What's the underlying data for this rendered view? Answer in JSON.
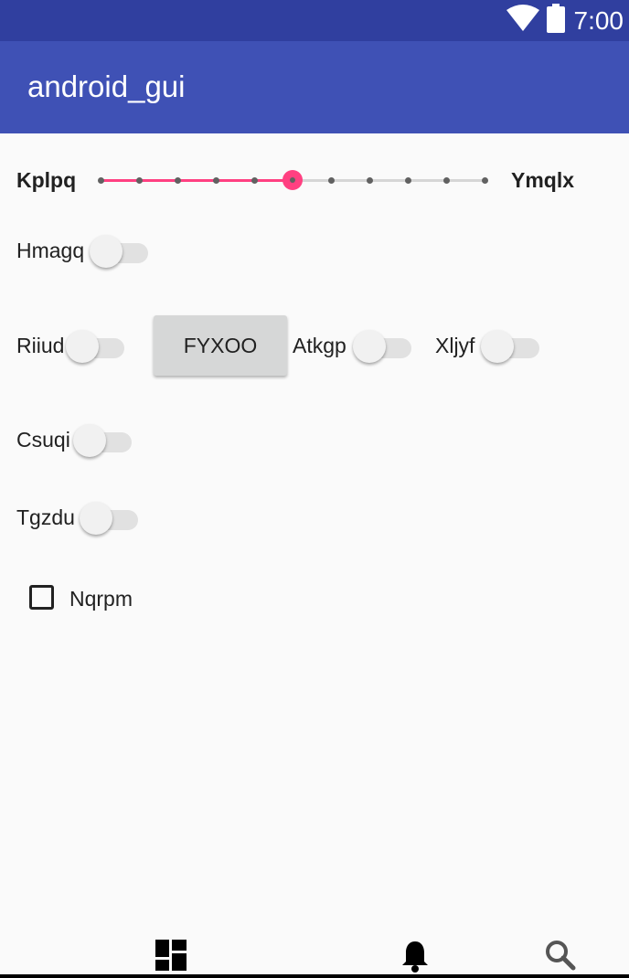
{
  "status_bar": {
    "time": "7:00",
    "icons": [
      "wifi-icon",
      "battery-icon"
    ],
    "color": "#303f9f"
  },
  "app_bar": {
    "title": "android_gui",
    "color": "#3f51b5"
  },
  "seekbar": {
    "label_start": "Kplpq",
    "label_end": "Ymqlx",
    "value": 5,
    "max": 10,
    "accent": "#ff4081"
  },
  "rows": {
    "hmagq": {
      "label": "Hmagq",
      "checked": false
    },
    "riiud": {
      "label": "Riiud",
      "checked": false
    },
    "button": {
      "label": "FYXOO"
    },
    "atkgp": {
      "label": "Atkgp",
      "checked": false
    },
    "xljyf": {
      "label": "Xljyf",
      "checked": false
    },
    "csuqi": {
      "label": "Csuqi",
      "checked": false
    },
    "tgzdu": {
      "label": "Tgzdu",
      "checked": false
    }
  },
  "checkbox": {
    "label": "Nqrpm",
    "checked": false
  },
  "bottom_nav": {
    "icons": [
      "dashboard-icon",
      "notifications-icon",
      "search-icon"
    ]
  }
}
